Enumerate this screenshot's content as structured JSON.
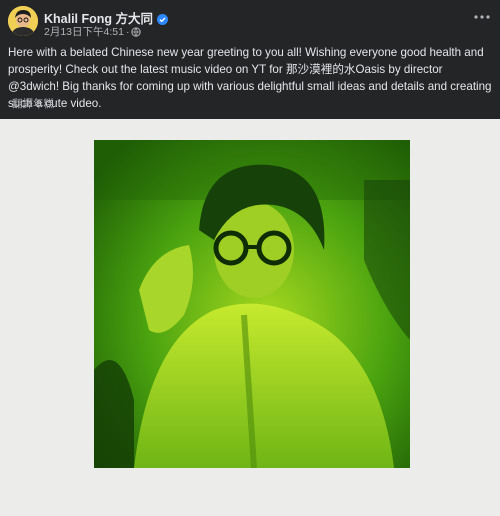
{
  "post": {
    "author_name": "Khalil Fong 方大同",
    "timestamp": "2月13日下午4:51",
    "visibility_icon": "globe-icon",
    "text": "Here with a belated Chinese new year greeting to you all! Wishing everyone good health and prosperity! Check out the latest music video on YT for 那沙漠裡的水Oasis by director @3dwich! Big thanks for coming up with various delightful small ideas and details and creating such a cute video.",
    "translate_label": "翻譯年糕"
  },
  "icons": {
    "verified": "verified-badge-icon",
    "more": "more-options-icon"
  },
  "colors": {
    "background": "#242526",
    "text": "#e4e6eb",
    "muted": "#b0b3b8",
    "verified": "#2d88ff",
    "photo_tint": "#4aa30f",
    "media_bg": "#ececea"
  }
}
